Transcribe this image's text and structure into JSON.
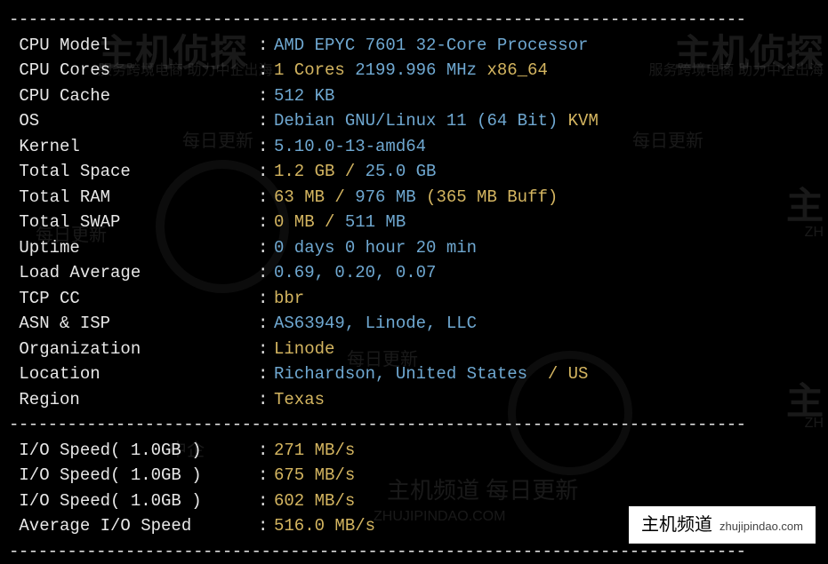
{
  "rows": [
    {
      "label": "CPU Model",
      "parts": [
        {
          "text": "AMD EPYC 7601 32-Core Processor",
          "color": "blue"
        }
      ]
    },
    {
      "label": "CPU Cores",
      "parts": [
        {
          "text": "1 Cores ",
          "color": "yellow"
        },
        {
          "text": "2199.996 MHz ",
          "color": "blue"
        },
        {
          "text": "x86_64",
          "color": "yellow"
        }
      ]
    },
    {
      "label": "CPU Cache",
      "parts": [
        {
          "text": "512 KB",
          "color": "blue"
        }
      ]
    },
    {
      "label": "OS",
      "parts": [
        {
          "text": "Debian GNU/Linux 11 (64 Bit) ",
          "color": "blue"
        },
        {
          "text": "KVM",
          "color": "yellow"
        }
      ]
    },
    {
      "label": "Kernel",
      "parts": [
        {
          "text": "5.10.0-13-amd64",
          "color": "blue"
        }
      ]
    },
    {
      "label": "Total Space",
      "parts": [
        {
          "text": "1.2 GB / ",
          "color": "yellow"
        },
        {
          "text": "25.0 GB",
          "color": "blue"
        }
      ]
    },
    {
      "label": "Total RAM",
      "parts": [
        {
          "text": "63 MB / ",
          "color": "yellow"
        },
        {
          "text": "976 MB ",
          "color": "blue"
        },
        {
          "text": "(365 MB Buff)",
          "color": "yellow"
        }
      ]
    },
    {
      "label": "Total SWAP",
      "parts": [
        {
          "text": "0 MB / ",
          "color": "yellow"
        },
        {
          "text": "511 MB",
          "color": "blue"
        }
      ]
    },
    {
      "label": "Uptime",
      "parts": [
        {
          "text": "0 days 0 hour 20 min",
          "color": "blue"
        }
      ]
    },
    {
      "label": "Load Average",
      "parts": [
        {
          "text": "0.69, 0.20, 0.07",
          "color": "blue"
        }
      ]
    },
    {
      "label": "TCP CC",
      "parts": [
        {
          "text": "bbr",
          "color": "yellow"
        }
      ]
    },
    {
      "label": "ASN & ISP",
      "parts": [
        {
          "text": "AS63949, Linode, LLC",
          "color": "blue"
        }
      ]
    },
    {
      "label": "Organization",
      "parts": [
        {
          "text": "Linode",
          "color": "yellow"
        }
      ]
    },
    {
      "label": "Location",
      "parts": [
        {
          "text": "Richardson, United States ",
          "color": "blue"
        },
        {
          "text": " / US",
          "color": "yellow"
        }
      ]
    },
    {
      "label": "Region",
      "parts": [
        {
          "text": "Texas",
          "color": "yellow"
        }
      ]
    }
  ],
  "io_rows": [
    {
      "label": "I/O Speed( 1.0GB )",
      "value": "271 MB/s"
    },
    {
      "label": "I/O Speed( 1.0GB )",
      "value": "675 MB/s"
    },
    {
      "label": "I/O Speed( 1.0GB )",
      "value": "602 MB/s"
    },
    {
      "label": "Average I/O Speed",
      "value": "516.0 MB/s"
    }
  ],
  "divider": "----------------------------------------------------------------------------",
  "watermarks": {
    "brand_cn": "主机侦探",
    "brand_tagline": "服务跨境电商 助力中企出海",
    "daily": "每日更新",
    "channel": "主机频道 每日更新",
    "domain1": "ZHUJIPINDAO.COM",
    "brand2": "主",
    "brand2sub": "ZH"
  },
  "footer": {
    "title": "主机频道",
    "url": "zhujipindao.com"
  }
}
